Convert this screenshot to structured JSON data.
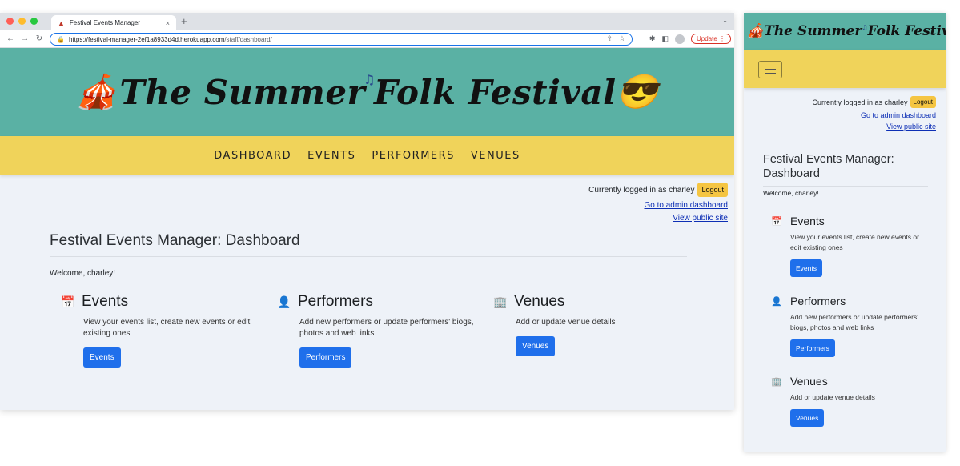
{
  "browser": {
    "tab_title": "Festival Events Manager",
    "tab_close": "×",
    "new_tab": "+",
    "url_host": "https://festival-manager-2ef1a8933d4d.herokuapp.com",
    "url_path": "/staff/dashboard/",
    "update_label": "Update"
  },
  "site": {
    "brand_part1": "The Summer",
    "brand_part2": "Folk Festival",
    "nav": [
      "DASHBOARD",
      "EVENTS",
      "PERFORMERS",
      "VENUES"
    ]
  },
  "user": {
    "logged_in_text": "Currently logged in as charley",
    "logout_label": "Logout",
    "admin_link": "Go to admin dashboard",
    "public_link": "View public site"
  },
  "page": {
    "title": "Festival Events Manager: Dashboard",
    "mobile_title": "Festival Events Manager: Dashboard",
    "welcome": "Welcome, charley!"
  },
  "cards": [
    {
      "title": "Events",
      "description": "View your events list, create new events or edit existing ones",
      "button": "Events",
      "icon": "calendar-icon"
    },
    {
      "title": "Performers",
      "description": "Add new performers or update performers' biogs, photos and web links",
      "button": "Performers",
      "icon": "person-badge-icon"
    },
    {
      "title": "Venues",
      "description": "Add or update venue details",
      "button": "Venues",
      "icon": "building-icon"
    }
  ],
  "colors": {
    "hero": "#5ab1a4",
    "nav": "#f0d35a",
    "button": "#1f6feb",
    "logout": "#f5c542"
  }
}
